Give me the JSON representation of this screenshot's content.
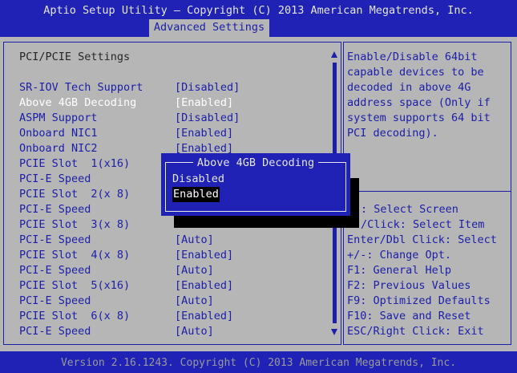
{
  "header": {
    "title": "Aptio Setup Utility – Copyright (C) 2013 American Megatrends, Inc.",
    "active_tab": "Advanced Settings"
  },
  "section_title": "PCI/PCIE Settings",
  "settings": [
    {
      "label": "SR-IOV Tech Support",
      "value": "[Disabled]"
    },
    {
      "label": "Above 4GB Decoding",
      "value": "[Enabled]",
      "selected": true
    },
    {
      "label": "ASPM Support",
      "value": "[Disabled]"
    },
    {
      "label": "Onboard NIC1",
      "value": "[Enabled]"
    },
    {
      "label": "Onboard NIC2",
      "value": "[Enabled]"
    },
    {
      "label": "PCIE Slot  1(x16)",
      "value": ""
    },
    {
      "label": "PCI-E Speed",
      "value": ""
    },
    {
      "label": "PCIE Slot  2(x 8)",
      "value": ""
    },
    {
      "label": "PCI-E Speed",
      "value": ""
    },
    {
      "label": "PCIE Slot  3(x 8)",
      "value": ""
    },
    {
      "label": "PCI-E Speed",
      "value": "[Auto]"
    },
    {
      "label": "PCIE Slot  4(x 8)",
      "value": "[Enabled]"
    },
    {
      "label": "PCI-E Speed",
      "value": "[Auto]"
    },
    {
      "label": "PCIE Slot  5(x16)",
      "value": "[Enabled]"
    },
    {
      "label": "PCI-E Speed",
      "value": "[Auto]"
    },
    {
      "label": "PCIE Slot  6(x 8)",
      "value": "[Enabled]"
    },
    {
      "label": "PCI-E Speed",
      "value": "[Auto]"
    }
  ],
  "help_text": [
    "Enable/Disable 64bit",
    "capable devices to be",
    "decoded in above 4G",
    "address space (Only if",
    "system supports 64 bit",
    "PCI decoding)."
  ],
  "key_help": [
    ": Select Screen",
    "/Click: Select Item",
    "Enter/Dbl Click: Select",
    "+/-: Change Opt.",
    "F1: General Help",
    "F2: Previous Values",
    "F9: Optimized Defaults",
    "F10: Save and Reset",
    "ESC/Right Click: Exit"
  ],
  "popup": {
    "title": "Above 4GB Decoding",
    "options": [
      "Disabled",
      "Enabled"
    ],
    "selected_option": "Enabled"
  },
  "footer": {
    "version": "Version 2.16.1243. Copyright (C) 2013 American Megatrends, Inc."
  },
  "colors": {
    "bar_blue": "#1f22b4",
    "panel_gray": "#b6b6b6",
    "text_blue": "#1c20a8",
    "highlight_white": "#ffffff"
  }
}
